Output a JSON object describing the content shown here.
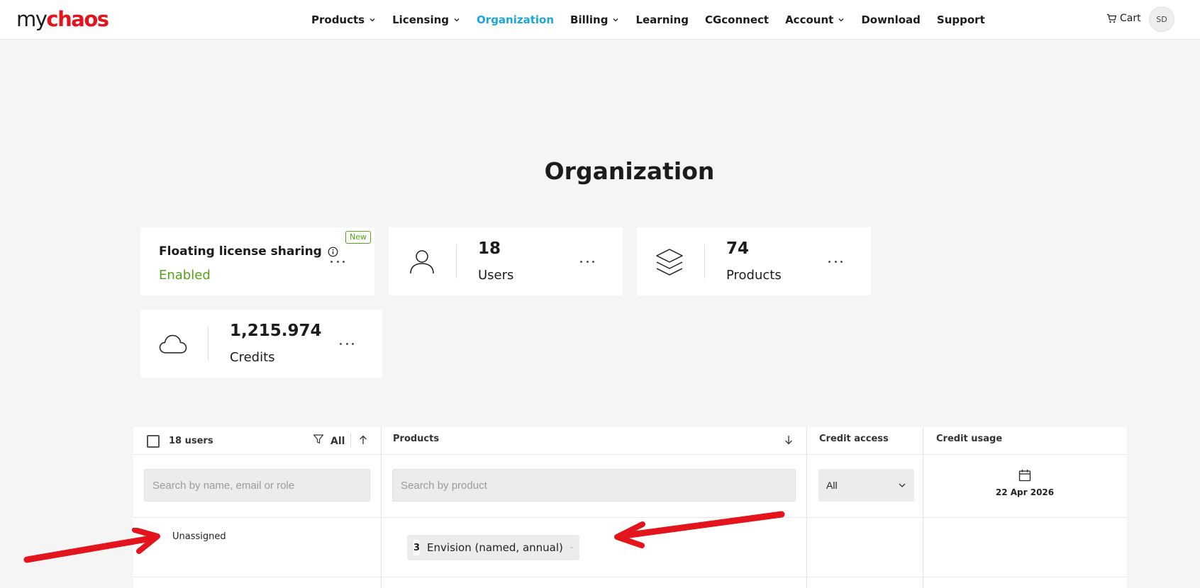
{
  "logo": {
    "my": "my",
    "chaos": "chaos"
  },
  "nav": {
    "items": [
      {
        "label": "Products",
        "dropdown": true
      },
      {
        "label": "Licensing",
        "dropdown": true
      },
      {
        "label": "Organization",
        "dropdown": false,
        "active": true
      },
      {
        "label": "Billing",
        "dropdown": true
      },
      {
        "label": "Learning",
        "dropdown": false
      },
      {
        "label": "CGconnect",
        "dropdown": false
      },
      {
        "label": "Account",
        "dropdown": true
      },
      {
        "label": "Download",
        "dropdown": false
      },
      {
        "label": "Support",
        "dropdown": false
      }
    ],
    "cart_label": "Cart",
    "avatar_initials": "SD"
  },
  "page": {
    "title": "Organization"
  },
  "cards": {
    "floating": {
      "title": "Floating license sharing",
      "status": "Enabled",
      "badge": "New"
    },
    "users": {
      "value": "18",
      "label": "Users"
    },
    "products": {
      "value": "74",
      "label": "Products"
    },
    "credits": {
      "value": "1,215.974",
      "label": "Credits"
    }
  },
  "table": {
    "users_header": "18 users",
    "filter_label": "All",
    "products_header": "Products",
    "credit_access_header": "Credit access",
    "credit_usage_header": "Credit usage",
    "search_users_placeholder": "Search by name, email or role",
    "search_products_placeholder": "Search by product",
    "credit_access_value": "All",
    "credit_usage_date": "22 Apr 2026",
    "rows": [
      {
        "user": "Unassigned",
        "product_count": "3",
        "product_name": "Envision (named, annual)"
      }
    ]
  },
  "colors": {
    "accent": "#1aa6e0",
    "brand": "#e3141b",
    "enabled": "#53a318",
    "annotation_arrow": "#e3141b"
  }
}
